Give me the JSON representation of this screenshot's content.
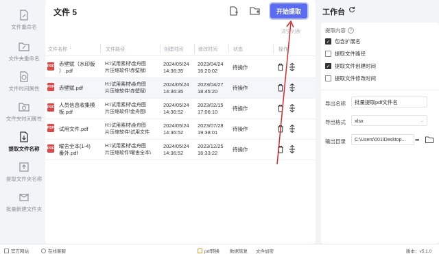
{
  "sidebar": {
    "items": [
      {
        "label": "文件重命名",
        "icon": "file-rename-icon"
      },
      {
        "label": "文件夹重命名",
        "icon": "folder-rename-icon"
      },
      {
        "label": "文件时间属性",
        "icon": "file-time-icon"
      },
      {
        "label": "文件夹时间属性",
        "icon": "folder-time-icon"
      },
      {
        "label": "提取文件名称",
        "icon": "extract-filename-icon"
      },
      {
        "label": "提取文件夹名称",
        "icon": "extract-foldername-icon"
      },
      {
        "label": "批量新建文件夹",
        "icon": "batch-new-folder-icon"
      }
    ]
  },
  "main": {
    "title": "文件 5",
    "start_button": "开始提取",
    "clear_list": "清空列表",
    "columns": [
      "文件名称",
      "文件路径",
      "创建时间",
      "修改时间",
      "状态",
      "操作"
    ],
    "rows": [
      {
        "name": [
          "赤壁赋（水印版",
          "）.pdf"
        ],
        "path": [
          "H:\\试用素材\\金舟图",
          "片压缩软件\\赤壁赋\\"
        ],
        "created": [
          "2024/05/24",
          "14:36:35"
        ],
        "modified": [
          "2023/04/24",
          "16:20:02"
        ],
        "status": "待操作"
      },
      {
        "name": [
          "赤壁赋.pdf"
        ],
        "path": [
          "H:\\试用素材\\金舟图",
          "片压缩软件\\赤壁赋\\"
        ],
        "created": [
          "2024/05/24",
          "14:36:35"
        ],
        "modified": [
          "2023/04/27",
          "18:45:20"
        ],
        "status": "待操作"
      },
      {
        "name": [
          "人员信息收集模",
          "板.pdf"
        ],
        "path": [
          "H:\\试用素材\\金舟图",
          "片压缩软件\\金舟图\\"
        ],
        "created": [
          "2024/05/24",
          "14:36:52"
        ],
        "modified": [
          "2023/02/15",
          "17:06:10"
        ],
        "status": "待操作"
      },
      {
        "name": [
          "试用文件.pdf"
        ],
        "path": [
          "H:\\试用素材\\金舟图",
          "片压缩软件\\试用文件"
        ],
        "created": [
          "2024/05/24",
          "14:36:52"
        ],
        "modified": [
          "2023/07/28",
          "19:38:01"
        ],
        "status": "待操作"
      },
      {
        "name": [
          "曜舍全本(1-4)",
          "番外.pdf"
        ],
        "path": [
          "H:\\试用素材\\金舟图",
          "片压缩软件\\曜舍全本\\"
        ],
        "created": [
          "2024/05/24",
          "14:36:52"
        ],
        "modified": [
          "2023/12/25",
          "16:33:22"
        ],
        "status": "待操作"
      }
    ]
  },
  "work": {
    "title": "工作台",
    "section_label": "提取内容",
    "options": [
      {
        "label": "包含扩展名",
        "checked": true
      },
      {
        "label": "提取文件路径",
        "checked": false
      },
      {
        "label": "提取文件创建时间",
        "checked": true
      },
      {
        "label": "提取文件修改时间",
        "checked": false
      }
    ],
    "export_name_label": "导出名称",
    "export_name_value": "批量提取pdf文件名",
    "export_format_label": "导出格式",
    "export_format_value": "xlsx",
    "output_dir_label": "输出目录",
    "output_dir_value": "C:\\Users\\001\\Desktop..."
  },
  "footer": {
    "website": "官方网站",
    "service": "在线客服",
    "pdf_convert": "pdf转换",
    "data_recovery": "数据恢复",
    "file_encrypt": "文件加密",
    "version": "版本：v5.1.0"
  },
  "colors": {
    "accent": "#5b6cf0",
    "pdf": "#e04545",
    "annotation": "#d42a2a"
  }
}
